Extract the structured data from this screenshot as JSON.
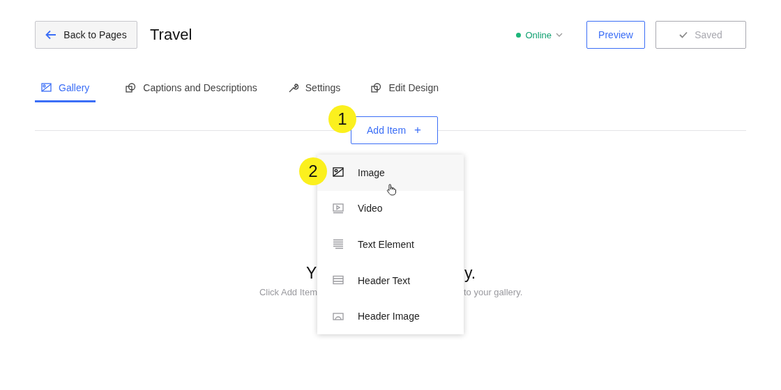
{
  "header": {
    "back_button": "Back to Pages",
    "title": "Travel",
    "status": {
      "label": "Online",
      "color": "#1db67a"
    },
    "preview_button": "Preview",
    "saved_button": {
      "label": "Saved",
      "disabled": true
    }
  },
  "tabs": [
    {
      "label": "Gallery",
      "kind": "gallery",
      "selected": true
    },
    {
      "label": "Captions and Descriptions",
      "kind": "captions",
      "selected": false
    },
    {
      "label": "Settings",
      "kind": "settings",
      "selected": false
    },
    {
      "label": "Edit Design",
      "kind": "design",
      "selected": false
    }
  ],
  "add_item_button": {
    "label": "Add Item",
    "plus": "+"
  },
  "step_badges": [
    "1",
    "2"
  ],
  "menu": {
    "items": [
      {
        "label": "Image",
        "kind": "image",
        "selected": true
      },
      {
        "label": "Video",
        "kind": "video",
        "selected": false
      },
      {
        "label": "Text Element",
        "kind": "text",
        "selected": false
      },
      {
        "label": "Header Text",
        "kind": "header_text",
        "selected": false
      },
      {
        "label": "Header Image",
        "kind": "header_image",
        "selected": false
      }
    ]
  },
  "empty_state": {
    "heading_left": "Y",
    "heading_right": "y.",
    "hint_left": "Click Add Item",
    "hint_right": "to your gallery."
  }
}
